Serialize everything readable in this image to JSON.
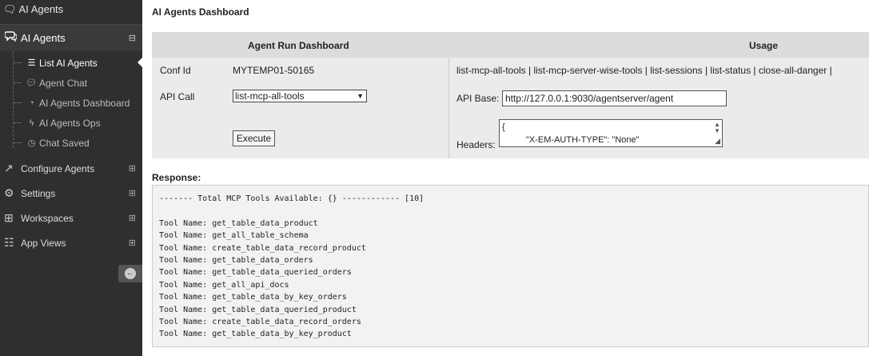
{
  "sidebar": {
    "top_label": "AI Agents",
    "main_label": "AI Agents",
    "main_toggle": "⊟",
    "sub_items": [
      {
        "label": "List AI Agents",
        "icon": "list-icon",
        "active": true
      },
      {
        "label": "Agent Chat",
        "icon": "chat-bubble-icon",
        "active": false
      },
      {
        "label": "AI Agents Dashboard",
        "icon": "dashboard-icon",
        "active": false
      },
      {
        "label": "AI Agents Ops",
        "icon": "bolt-icon",
        "active": false
      },
      {
        "label": "Chat Saved",
        "icon": "clock-icon",
        "active": false
      }
    ],
    "items": [
      {
        "label": "Configure Agents",
        "icon": "external-link-icon",
        "toggle": "⊞"
      },
      {
        "label": "Settings",
        "icon": "gears-icon",
        "toggle": "⊞"
      },
      {
        "label": "Workspaces",
        "icon": "plus-square-icon",
        "toggle": "⊞"
      },
      {
        "label": "App Views",
        "icon": "sitemap-icon",
        "toggle": "⊞"
      }
    ]
  },
  "page": {
    "title": "AI Agents Dashboard"
  },
  "panel": {
    "left_header": "Agent Run Dashboard",
    "right_header": "Usage",
    "conf_id_label": "Conf Id",
    "conf_id_value": "MYTEMP01-50165",
    "api_call_label": "API Call",
    "api_call_selected": "list-mcp-all-tools",
    "execute_label": "Execute",
    "usage_links": "list-mcp-all-tools | list-mcp-server-wise-tools | list-sessions | list-status | close-all-danger |",
    "api_base_label": "API Base:",
    "api_base_value": "http://127.0.0.1:9030/agentserver/agent",
    "headers_label": "Headers:",
    "headers_line1": "{",
    "headers_line2": "\"X-EM-AUTH-TYPE\": \"None\""
  },
  "response": {
    "label": "Response:",
    "lines": [
      "------- Total MCP Tools Available: {} ------------ [10]",
      "",
      "Tool Name: get_table_data_product",
      "Tool Name: get_all_table_schema",
      "Tool Name: create_table_data_record_product",
      "Tool Name: get_table_data_orders",
      "Tool Name: get_table_data_queried_orders",
      "Tool Name: get_all_api_docs",
      "Tool Name: get_table_data_by_key_orders",
      "Tool Name: get_table_data_queried_product",
      "Tool Name: create_table_data_record_orders",
      "Tool Name: get_table_data_by_key_product"
    ]
  }
}
